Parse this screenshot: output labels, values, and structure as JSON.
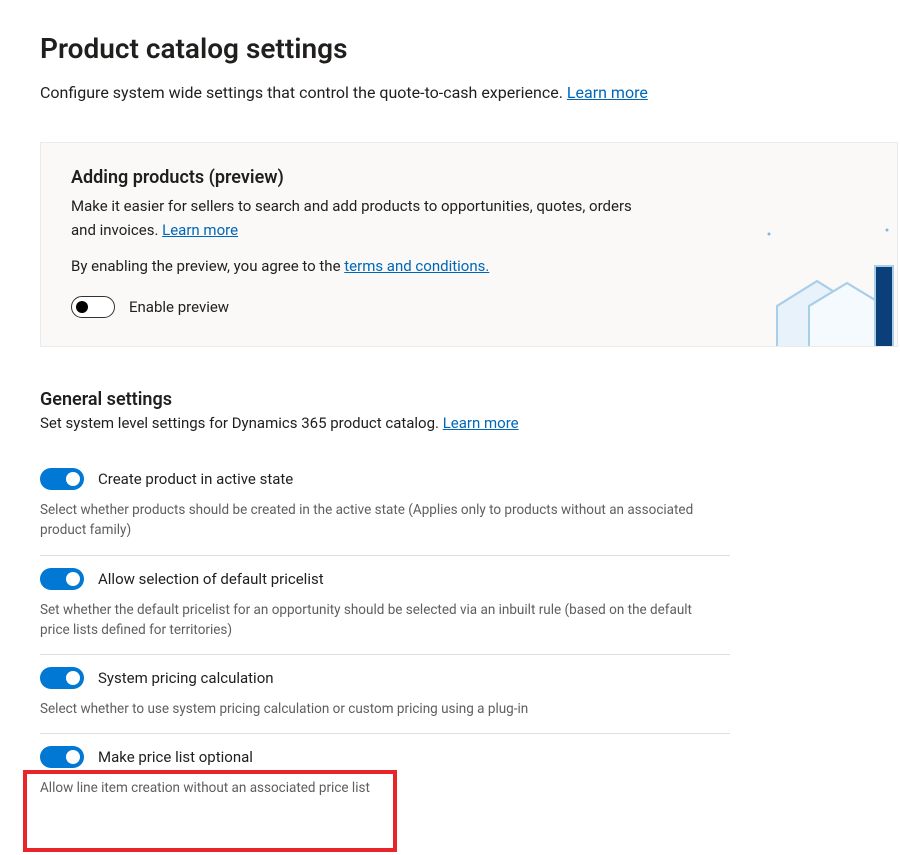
{
  "page": {
    "title": "Product catalog settings",
    "description": "Configure system wide settings that control the quote-to-cash experience. ",
    "learn_more": "Learn more"
  },
  "preview_card": {
    "title": "Adding products (preview)",
    "desc": "Make it easier for sellers to search and add products to opportunities, quotes, orders and invoices. ",
    "learn_more": "Learn more",
    "agree_prefix": "By enabling the preview, you agree to the ",
    "terms": "terms and conditions.",
    "toggle_label": "Enable preview",
    "toggle_state": false
  },
  "general": {
    "title": "General settings",
    "subtitle_prefix": "Set system level settings for Dynamics 365 product catalog. ",
    "learn_more": "Learn more",
    "settings": [
      {
        "label": "Create product in active state",
        "desc": "Select whether products should be created in the active state (Applies only to products without an associated product family)",
        "on": true
      },
      {
        "label": "Allow selection of default pricelist",
        "desc": "Set whether the default pricelist for an opportunity should be selected via an inbuilt rule (based on the default price lists defined for territories)",
        "on": true
      },
      {
        "label": "System pricing calculation",
        "desc": "Select whether to use system pricing calculation or custom pricing using a plug-in",
        "on": true
      },
      {
        "label": "Make price list optional",
        "desc": "Allow line item creation without an associated price list",
        "on": true
      }
    ]
  }
}
